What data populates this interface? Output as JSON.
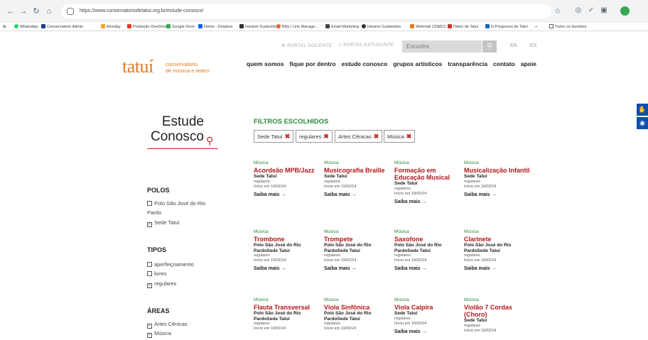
{
  "browser": {
    "url": "https://www.conservatoriodetatui.org.br/estude-conosco/",
    "bookmarks": [
      {
        "label": "WhatsApp",
        "color": "#25d366"
      },
      {
        "label": "Conservatório Admin",
        "color": "#1f3b8a"
      },
      {
        "label": "Monday",
        "color": "#f6a623"
      },
      {
        "label": "Produção OneDrive",
        "color": "#e33b2e"
      },
      {
        "label": "Google Drive",
        "color": "#34a853"
      },
      {
        "label": "Home - Dropbox",
        "color": "#0061fe"
      },
      {
        "label": "Intranet Sustenidos",
        "color": "#333333"
      },
      {
        "label": "Bitly | Link Manage...",
        "color": "#ee6123"
      },
      {
        "label": "Email Marketing",
        "color": "#444444"
      },
      {
        "label": "Intranet Sustenidos",
        "color": "#333333"
      },
      {
        "label": "Webmail CDMCC",
        "color": "#e37a1f"
      },
      {
        "label": "Diário de Tatuí",
        "color": "#d32f2f"
      },
      {
        "label": "O Progresso de Tatuí",
        "color": "#1565c0"
      },
      {
        "label": "»",
        "color": ""
      },
      {
        "label": "Todos os favoritos",
        "color": ""
      }
    ]
  },
  "header": {
    "portal_docente": "PORTAL DOCENTE",
    "portal_estudante": "PORTAL ESTUDANTE",
    "search_placeholder": "Encontre",
    "lang_en": "EN",
    "lang_es": "ES",
    "logo_word": "tatuí",
    "logo_sub_1": "conservatório",
    "logo_sub_2": "de música e teatro",
    "nav": [
      "quem somos",
      "fique por dentro",
      "estude conosco",
      "grupos artísticos",
      "transparência",
      "contato",
      "apoie"
    ]
  },
  "sidebar": {
    "title_1": "Estude",
    "title_2": "Conosco",
    "polos_heading": "POLOS",
    "polos": [
      {
        "label": "Polo São José do Rio Pardo",
        "checked": false
      },
      {
        "label": "Sede Tatuí",
        "checked": true
      }
    ],
    "tipos_heading": "TIPOS",
    "tipos": [
      {
        "label": "aperfeiçoamento",
        "checked": false
      },
      {
        "label": "livres",
        "checked": false
      },
      {
        "label": "regulares",
        "checked": true
      }
    ],
    "areas_heading": "ÁREAS",
    "areas": [
      {
        "label": "Artes Cênicas",
        "checked": true
      },
      {
        "label": "Música",
        "checked": true
      }
    ]
  },
  "filters": {
    "heading": "FILTROS ESCOLHIDOS",
    "chips": [
      "Sede Tatuí",
      "regulares",
      "Artes Cênicas",
      "Música"
    ]
  },
  "courses": [
    {
      "area": "Música",
      "title": "Acordeão MPB/Jazz",
      "polo": "Sede Tatuí",
      "tipo": "regulares",
      "inicio": "Início em 19/02/24",
      "more": "Saiba mais →"
    },
    {
      "area": "Música",
      "title": "Musicografia Braille",
      "polo": "Sede Tatuí",
      "tipo": "regulares",
      "inicio": "Início em 19/02/24",
      "more": "Saiba mais →"
    },
    {
      "area": "Música",
      "title": "Formação em Educação Musical",
      "polo": "Sede Tatuí",
      "tipo": "regulares",
      "inicio": "Início em 19/02/24",
      "more": "Saiba mais →"
    },
    {
      "area": "Música",
      "title": "Musicalização Infantil",
      "polo": "Sede Tatuí",
      "tipo": "regulares",
      "inicio": "Início em 19/02/24",
      "more": "Saiba mais →"
    },
    {
      "area": "Música",
      "title": "Trombone",
      "polo": "Polo São José do Rio PardoSede Tatuí",
      "tipo": "regulares",
      "inicio": "Início em 19/02/24",
      "more": "Saiba mais →"
    },
    {
      "area": "Música",
      "title": "Trompete",
      "polo": "Polo São José do Rio PardoSede Tatuí",
      "tipo": "regulares",
      "inicio": "Início em 19/02/24",
      "more": "Saiba mais →"
    },
    {
      "area": "Música",
      "title": "Saxofone",
      "polo": "Polo São José do Rio PardoSede Tatuí",
      "tipo": "regulares",
      "inicio": "Início em 19/02/24",
      "more": "Saiba mais →"
    },
    {
      "area": "Música",
      "title": "Clarinete",
      "polo": "Polo São José do Rio PardoSede Tatuí",
      "tipo": "regulares",
      "inicio": "Início em 19/02/24",
      "more": "Saiba mais →"
    },
    {
      "area": "Música",
      "title": "Flauta Transversal",
      "polo": "Polo São José do Rio PardoSede Tatuí",
      "tipo": "regulares",
      "inicio": "Início em 19/02/24",
      "more": ""
    },
    {
      "area": "Música",
      "title": "Viola Sinfônica",
      "polo": "Polo São José do Rio PardoSede Tatuí",
      "tipo": "regulares",
      "inicio": "Início em 19/02/24",
      "more": ""
    },
    {
      "area": "Música",
      "title": "Viola Caipira",
      "polo": "Sede Tatuí",
      "tipo": "regulares",
      "inicio": "Início em 19/02/24",
      "more": "Saiba mais →"
    },
    {
      "area": "Música",
      "title": "Violão 7 Cordas (Choro)",
      "polo": "Sede Tatuí",
      "tipo": "regulares",
      "inicio": "Início em 19/02/24",
      "more": ""
    }
  ]
}
